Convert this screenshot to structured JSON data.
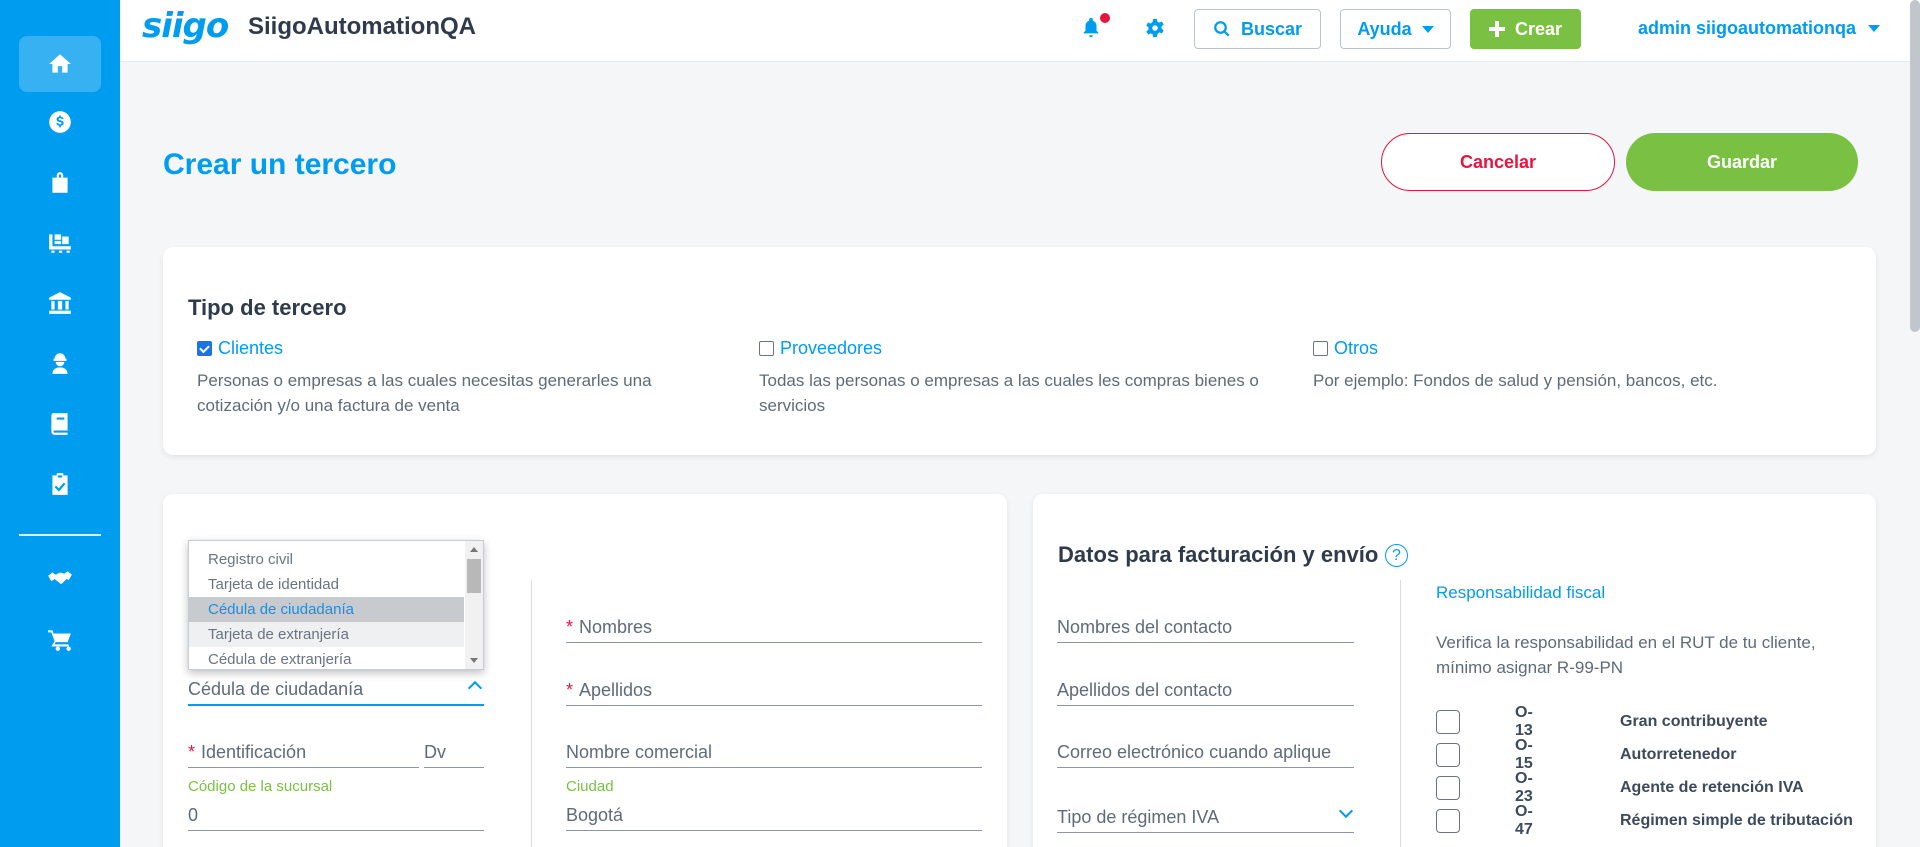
{
  "header": {
    "logo": "siigo",
    "company": "SiigoAutomationQA",
    "search_label": "Buscar",
    "help_label": "Ayuda",
    "create_label": "Crear",
    "user_label": "admin siigoautomationqa"
  },
  "sidebar": {
    "items": [
      {
        "icon": "home-icon"
      },
      {
        "icon": "dollar-icon"
      },
      {
        "icon": "shopping-bag-icon"
      },
      {
        "icon": "pallet-icon"
      },
      {
        "icon": "bank-icon"
      },
      {
        "icon": "worker-icon"
      },
      {
        "icon": "book-icon"
      },
      {
        "icon": "clipboard-check-icon"
      },
      {
        "icon": "handshake-icon"
      },
      {
        "icon": "cart-icon"
      }
    ]
  },
  "page": {
    "title": "Crear un tercero",
    "cancel_label": "Cancelar",
    "save_label": "Guardar"
  },
  "tipo": {
    "title": "Tipo de tercero",
    "options": [
      {
        "label": "Clientes",
        "checked": true,
        "desc1": "Personas o empresas a las cuales necesitas generarles una",
        "desc2": "cotización y/o una factura de venta"
      },
      {
        "label": "Proveedores",
        "checked": false,
        "desc1": "Todas las personas o empresas a las cuales les compras bienes o",
        "desc2": "servicios"
      },
      {
        "label": "Otros",
        "checked": false,
        "desc1": "Por ejemplo: Fondos de salud y pensión, bancos, etc.",
        "desc2": ""
      }
    ]
  },
  "document": {
    "options": [
      "Registro civil",
      "Tarjeta de identidad",
      "Cédula de ciudadanía",
      "Tarjeta de extranjería",
      "Cédula de extranjería"
    ],
    "selected": "Cédula de ciudadanía",
    "id_label": "Identificación",
    "dv_label": "Dv",
    "branch_label": "Código de la sucursal",
    "branch_value": "0"
  },
  "person": {
    "names_label": "Nombres",
    "surnames_label": "Apellidos",
    "trade_name_label": "Nombre comercial",
    "city_label": "Ciudad",
    "city_value": "Bogotá"
  },
  "billing": {
    "title": "Datos para facturación y envío",
    "help": "?",
    "contact_names": "Nombres del contacto",
    "contact_surnames": "Apellidos del contacto",
    "email": "Correo electrónico cuando aplique",
    "iva_regime": "Tipo de régimen IVA",
    "resp_title": "Responsabilidad fiscal",
    "resp_desc": "Verifica la responsabilidad en el RUT de tu cliente, mínimo asignar R-99-PN",
    "responsibilities": [
      {
        "code": "O-13",
        "name": "Gran contribuyente"
      },
      {
        "code": "O-15",
        "name": "Autorretenedor"
      },
      {
        "code": "O-23",
        "name": "Agente de retención IVA"
      },
      {
        "code": "O-47",
        "name": "Régimen simple de tributación"
      }
    ]
  },
  "colors": {
    "brand_blue": "#009cf0",
    "green": "#7ac143",
    "danger": "#e5153d"
  }
}
